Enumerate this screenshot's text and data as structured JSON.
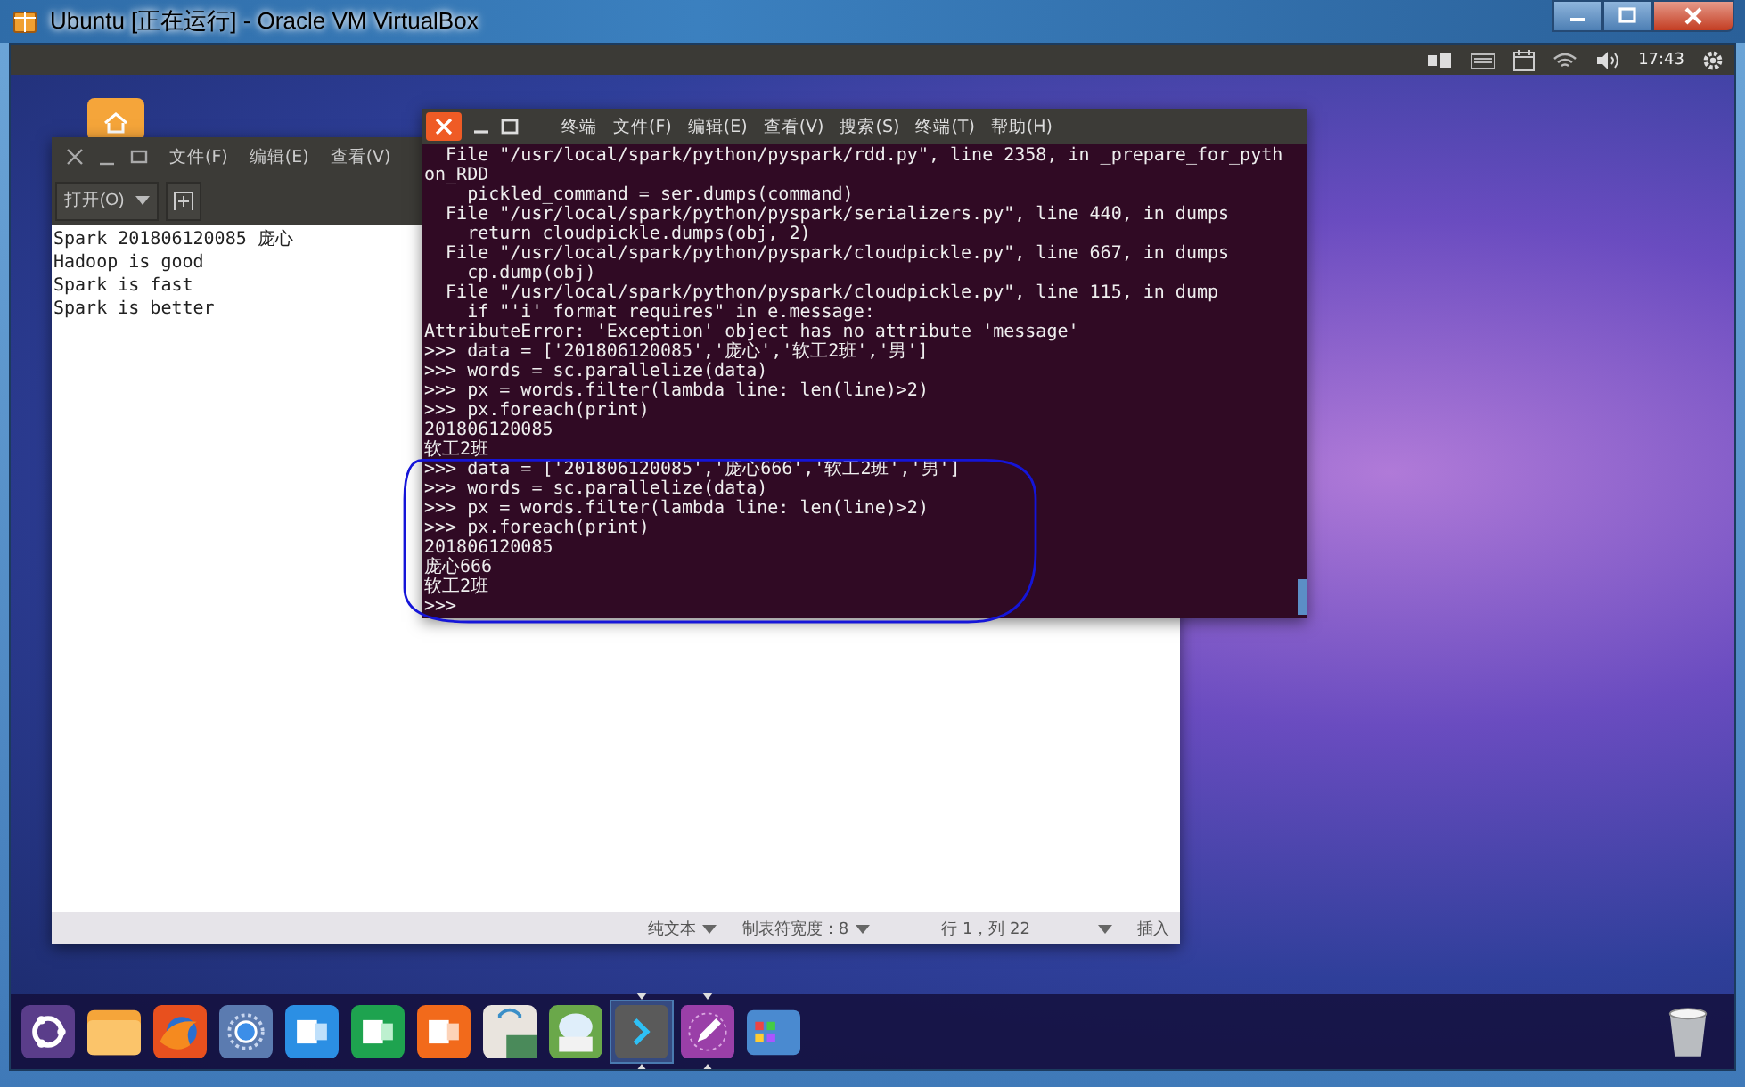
{
  "window": {
    "title": "Ubuntu [正在运行] - Oracle VM VirtualBox"
  },
  "top_panel": {
    "clock": "17:43"
  },
  "text_editor": {
    "menu": [
      "文件(F)",
      "编辑(E)",
      "查看(V)"
    ],
    "open_button": "打开(O)",
    "lines": [
      "Spark 201806120085 庞心",
      "Hadoop is good",
      "Spark is fast",
      "Spark is better"
    ],
    "status_bar": {
      "language": "纯文本",
      "tab_width": "制表符宽度：8",
      "position": "行 1，列 22",
      "mode": "插入"
    }
  },
  "terminal": {
    "menu": [
      "终端",
      "文件(F)",
      "编辑(E)",
      "查看(V)",
      "搜索(S)",
      "终端(T)",
      "帮助(H)"
    ],
    "lines": [
      "  File \"/usr/local/spark/python/pyspark/rdd.py\", line 2358, in _prepare_for_pyth",
      "on_RDD",
      "    pickled_command = ser.dumps(command)",
      "  File \"/usr/local/spark/python/pyspark/serializers.py\", line 440, in dumps",
      "    return cloudpickle.dumps(obj, 2)",
      "  File \"/usr/local/spark/python/pyspark/cloudpickle.py\", line 667, in dumps",
      "    cp.dump(obj)",
      "  File \"/usr/local/spark/python/pyspark/cloudpickle.py\", line 115, in dump",
      "    if \"'i' format requires\" in e.message:",
      "AttributeError: 'Exception' object has no attribute 'message'",
      ">>> data = ['201806120085','庞心','软工2班','男']",
      ">>> words = sc.parallelize(data)",
      ">>> px = words.filter(lambda line: len(line)>2)",
      ">>> px.foreach(print)",
      "201806120085",
      "软工2班",
      ">>> data = ['201806120085','庞心666','软工2班','男']",
      ">>> words = sc.parallelize(data)",
      ">>> px = words.filter(lambda line: len(line)>2)",
      ">>> px.foreach(print)",
      "201806120085",
      "庞心666",
      "软工2班",
      ">>>"
    ]
  },
  "dock": {
    "items": [
      {
        "kind": "ubuntu",
        "running": false,
        "selected": false
      },
      {
        "kind": "files",
        "running": false,
        "selected": false
      },
      {
        "kind": "firefox",
        "running": false,
        "selected": false
      },
      {
        "kind": "chromium",
        "running": false,
        "selected": false
      },
      {
        "kind": "word",
        "running": false,
        "selected": false
      },
      {
        "kind": "excel",
        "running": false,
        "selected": false
      },
      {
        "kind": "powerpoint",
        "running": false,
        "selected": false
      },
      {
        "kind": "store",
        "running": false,
        "selected": false
      },
      {
        "kind": "backup",
        "running": false,
        "selected": false
      },
      {
        "kind": "terminal",
        "running": true,
        "selected": true
      },
      {
        "kind": "editor",
        "running": true,
        "selected": false
      },
      {
        "kind": "apps",
        "running": false,
        "selected": false
      }
    ]
  }
}
